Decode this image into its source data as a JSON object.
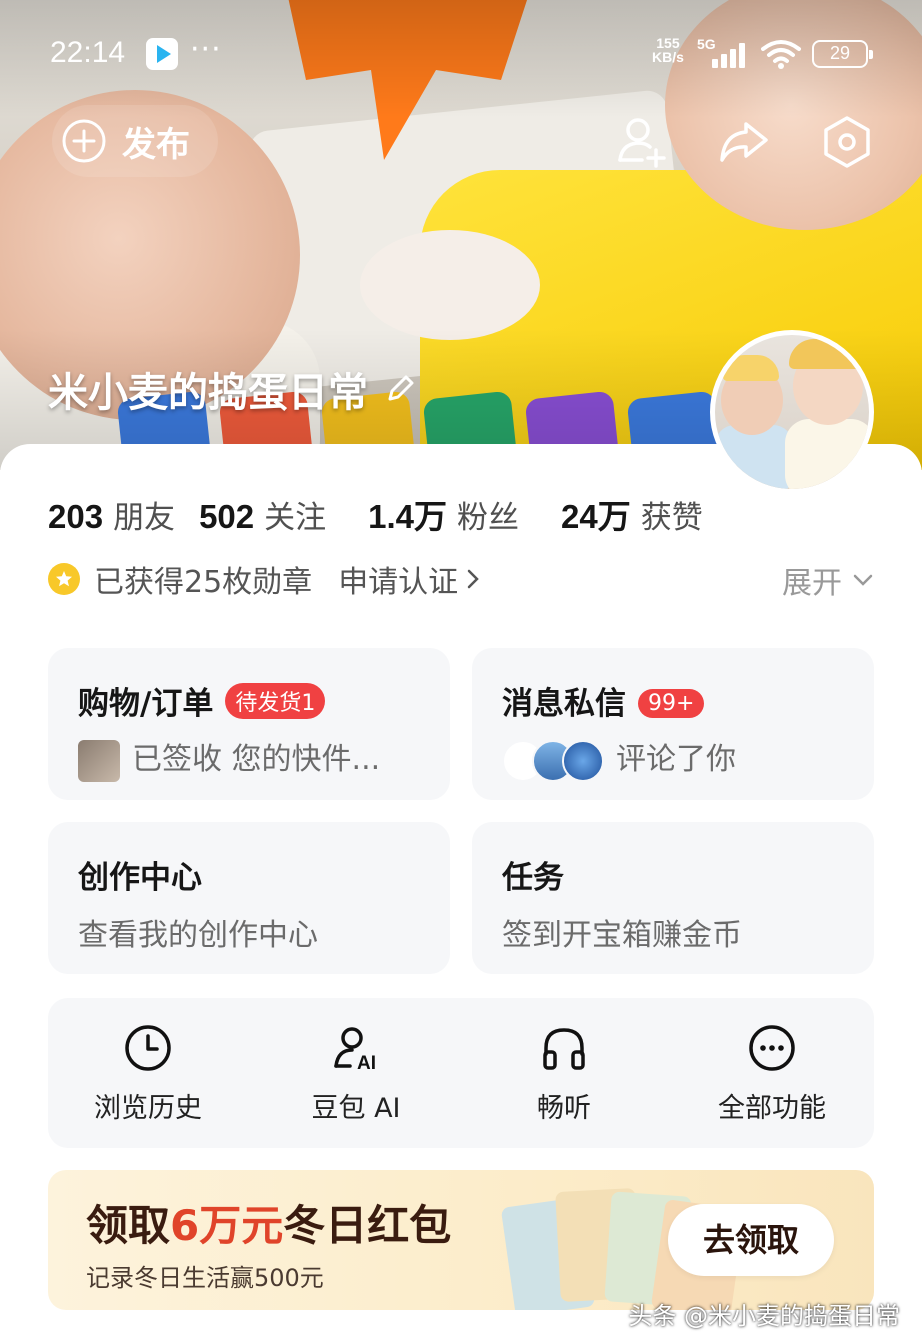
{
  "status_bar": {
    "time": "22:14",
    "more_dots": "···",
    "net_speed_top": "155",
    "net_speed_bottom": "KB/s",
    "network": "5G",
    "battery": "29"
  },
  "header": {
    "publish_label": "发布",
    "profile_name": "米小麦的捣蛋日常"
  },
  "stats": [
    {
      "value": "203",
      "label": "朋友"
    },
    {
      "value": "502",
      "label": "关注"
    },
    {
      "value": "1.4万",
      "label": "粉丝"
    },
    {
      "value": "24万",
      "label": "获赞"
    }
  ],
  "badges": {
    "text": "已获得25枚勋章",
    "cert_link": "申请认证",
    "expand": "展开"
  },
  "cards": {
    "order": {
      "title": "购物/订单",
      "pill": "待发货1",
      "sub": "已签收 您的快件..."
    },
    "message": {
      "title": "消息私信",
      "pill": "99+",
      "sub": "评论了你"
    },
    "create": {
      "title": "创作中心",
      "sub": "查看我的创作中心"
    },
    "task": {
      "title": "任务",
      "sub": "签到开宝箱赚金币"
    }
  },
  "tools": [
    {
      "label": "浏览历史",
      "icon": "clock-icon"
    },
    {
      "label": "豆包 AI",
      "icon": "ai-assistant-icon"
    },
    {
      "label": "畅听",
      "icon": "headphones-icon"
    },
    {
      "label": "全部功能",
      "icon": "more-circle-icon"
    }
  ],
  "banner": {
    "title_prefix": "领取",
    "title_highlight": "6万元",
    "title_suffix": "冬日红包",
    "subtitle": "记录冬日生活赢500元",
    "button": "去领取"
  },
  "watermark": "头条 @米小麦的捣蛋日常",
  "colors": {
    "accent_red": "#f04142",
    "banner_highlight": "#e0442a",
    "medal_gold": "#f8c829",
    "card_bg": "#f6f7f9"
  }
}
